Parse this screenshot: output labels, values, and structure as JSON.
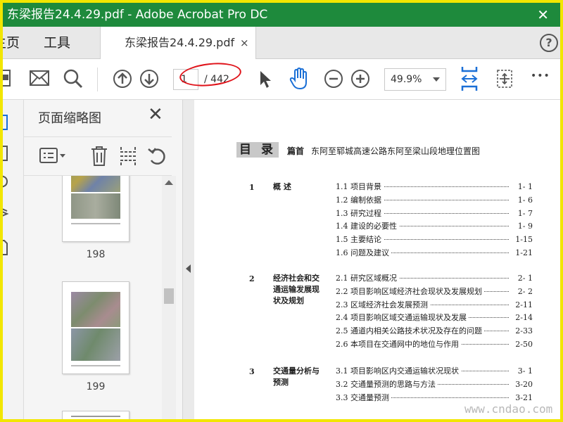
{
  "window": {
    "title": "东梁报告24.4.29.pdf - Adobe Acrobat Pro DC",
    "close_glyph": "✕"
  },
  "tabs": {
    "home": "主页",
    "tools": "工具",
    "document": "东梁报告24.4.29.pdf",
    "document_close": "×",
    "help": "?"
  },
  "toolbar": {
    "page_current": "1",
    "page_total": "/ 442",
    "zoom": "49.9%",
    "more": "•••"
  },
  "thumbnails_pane": {
    "title": "页面缩略图",
    "close": "✕",
    "pages": [
      {
        "number": "198"
      },
      {
        "number": "199"
      }
    ]
  },
  "document": {
    "toc_heading": "目  录",
    "toc_sub_label": "篇首",
    "toc_sub_text": "东阿至郓城高速公路东阿至梁山段地理位置图",
    "sections": [
      {
        "num": "1",
        "title": "概  述",
        "items": [
          {
            "label": "1.1 项目背景",
            "page": "1- 1"
          },
          {
            "label": "1.2 编制依据",
            "page": "1- 6"
          },
          {
            "label": "1.3 研究过程",
            "page": "1- 7"
          },
          {
            "label": "1.4 建设的必要性",
            "page": "1- 9"
          },
          {
            "label": "1.5 主要结论",
            "page": "1-15"
          },
          {
            "label": "1.6 问题及建议",
            "page": "1-21"
          }
        ]
      },
      {
        "num": "2",
        "title": "经济社会和交通运输发展现状及规划",
        "items": [
          {
            "label": "2.1 研究区域概况",
            "page": "2- 1"
          },
          {
            "label": "2.2 项目影响区域经济社会现状及发展规划",
            "page": "2- 2"
          },
          {
            "label": "2.3 区域经济社会发展预测",
            "page": "2-11"
          },
          {
            "label": "2.4 项目影响区域交通运输现状及发展",
            "page": "2-14"
          },
          {
            "label": "2.5 通道内相关公路技术状况及存在的问题",
            "page": "2-33"
          },
          {
            "label": "2.6 本项目在交通网中的地位与作用",
            "page": "2-50"
          }
        ]
      },
      {
        "num": "3",
        "title": "交通量分析与预测",
        "items": [
          {
            "label": "3.1 项目影响区内交通运输状况现状",
            "page": "3- 1"
          },
          {
            "label": "3.2 交通量预测的思路与方法",
            "page": "3-20"
          },
          {
            "label": "3.3 交通量预测",
            "page": "3-21"
          }
        ]
      }
    ]
  },
  "watermark": "www.cndao.com"
}
